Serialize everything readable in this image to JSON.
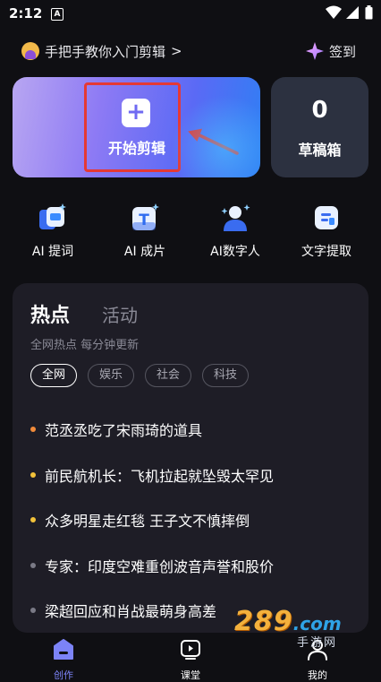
{
  "status_bar": {
    "time": "2:12",
    "app_badge": "A"
  },
  "header": {
    "tutorial_text": "手把手教你入门剪辑",
    "tutorial_chevron": ">",
    "checkin_label": "签到"
  },
  "start_card": {
    "label": "开始剪辑",
    "plus": "+"
  },
  "drafts": {
    "count": "0",
    "label": "草稿箱"
  },
  "tools": [
    {
      "label": "AI 提词",
      "icon": "ai-prompt-icon"
    },
    {
      "label": "AI 成片",
      "icon": "ai-video-icon"
    },
    {
      "label": "AI数字人",
      "icon": "ai-avatar-icon"
    },
    {
      "label": "文字提取",
      "icon": "text-extract-icon"
    }
  ],
  "hot": {
    "tabs": [
      "热点",
      "活动"
    ],
    "subtitle": "全网热点 每分钟更新",
    "chips": [
      "全网",
      "娱乐",
      "社会",
      "科技"
    ],
    "items": [
      {
        "text": "范丞丞吃了宋雨琦的道具",
        "dot_color": "#f28b3a"
      },
      {
        "text": "前民航机长：飞机拉起就坠毁太罕见",
        "dot_color": "#f2c23a"
      },
      {
        "text": "众多明星走红毯 王子文不慎摔倒",
        "dot_color": "#f2c23a"
      },
      {
        "text": "专家：印度空难重创波音声誉和股价",
        "dot_color": "#7a7a86"
      },
      {
        "text": "梁超回应和肖战最萌身高差",
        "dot_color": "#7a7a86"
      }
    ]
  },
  "nav": [
    {
      "label": "创作",
      "icon": "create-icon",
      "active": true
    },
    {
      "label": "课堂",
      "icon": "classroom-icon",
      "active": false
    },
    {
      "label": "我的",
      "icon": "profile-icon",
      "active": false
    }
  ],
  "watermark": {
    "num": "289",
    "com": ".com",
    "sub": "手游网"
  },
  "colors": {
    "accent": "#6f6af2",
    "nav_active": "#7c83f7",
    "highlight": "#e53935"
  }
}
